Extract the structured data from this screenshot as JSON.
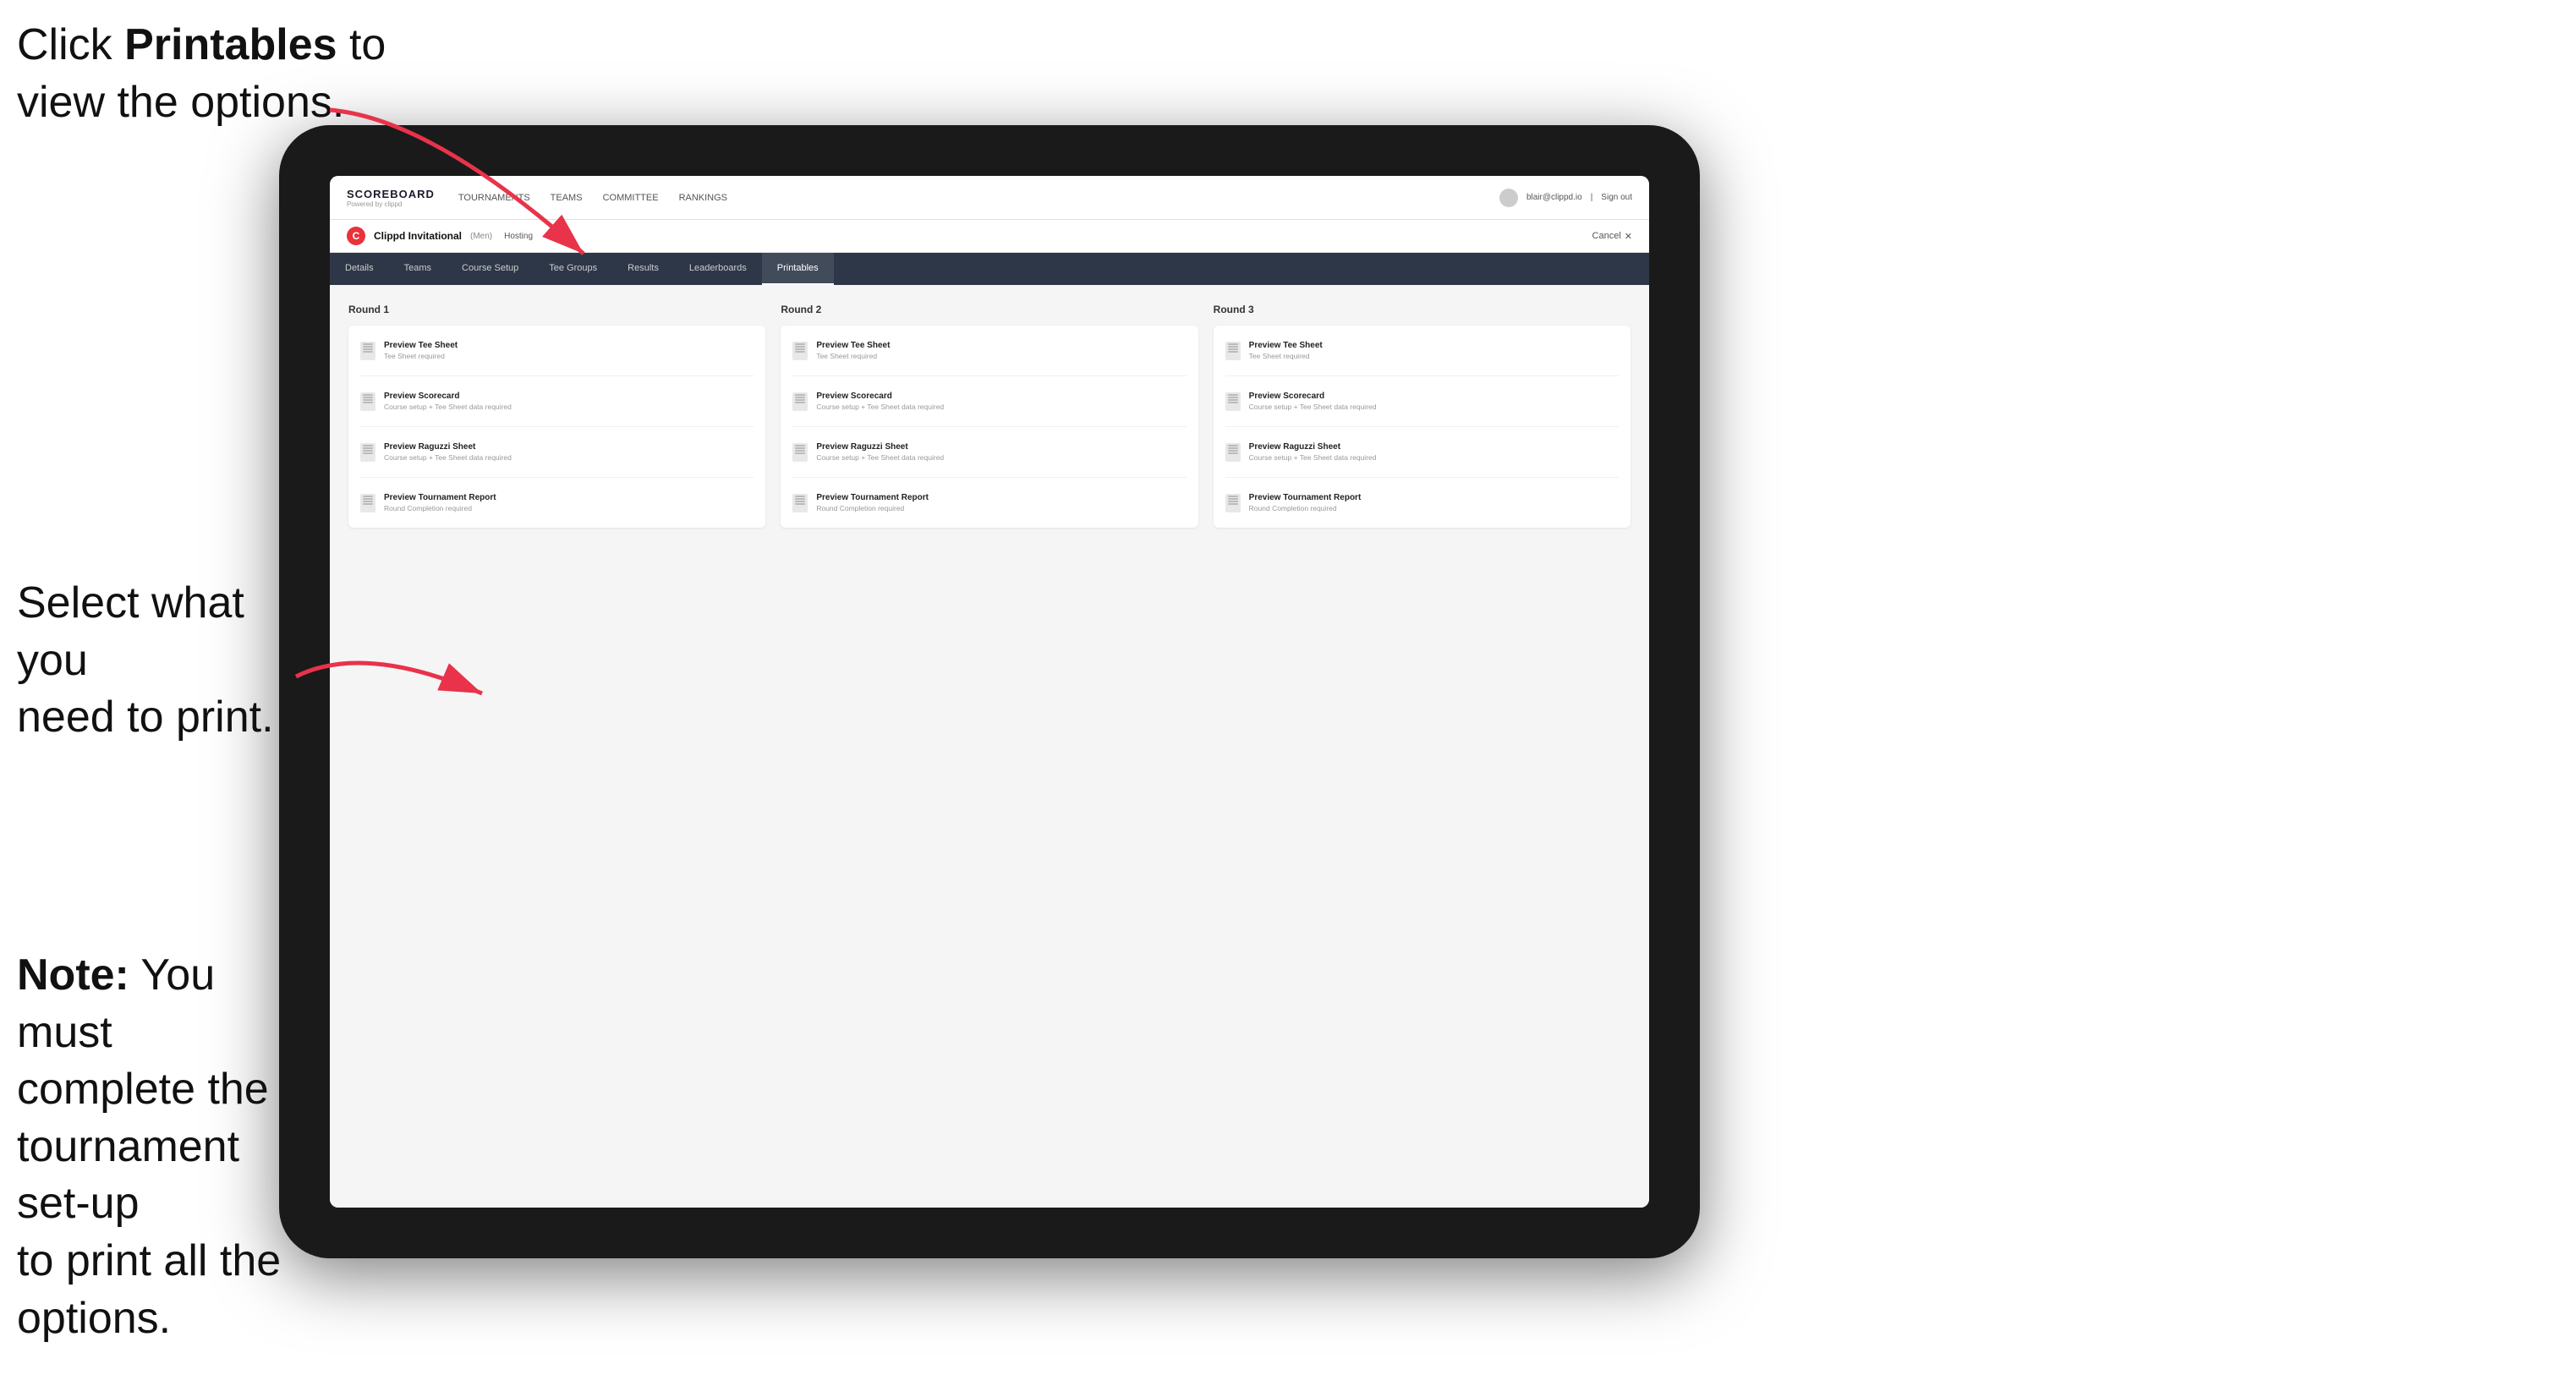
{
  "annotation": {
    "top_line1": "Click ",
    "top_bold": "Printables",
    "top_line2": " to",
    "top_line3": "view the options.",
    "middle_line1": "Select what you",
    "middle_line2": "need to print.",
    "bottom_bold": "Note:",
    "bottom_line1": " You must",
    "bottom_line2": "complete the",
    "bottom_line3": "tournament set-up",
    "bottom_line4": "to print all the options."
  },
  "nav": {
    "logo_title": "SCOREBOARD",
    "logo_subtitle": "Powered by clippd",
    "links": [
      {
        "label": "TOURNAMENTS",
        "active": false
      },
      {
        "label": "TEAMS",
        "active": false
      },
      {
        "label": "COMMITTEE",
        "active": false
      },
      {
        "label": "RANKINGS",
        "active": false
      }
    ],
    "user": "blair@clippd.io",
    "sign_out": "Sign out"
  },
  "tournament": {
    "logo_letter": "C",
    "name": "Clippd Invitational",
    "tag": "(Men)",
    "hosting": "Hosting",
    "cancel": "Cancel"
  },
  "sub_tabs": [
    {
      "label": "Details",
      "active": false
    },
    {
      "label": "Teams",
      "active": false
    },
    {
      "label": "Course Setup",
      "active": false
    },
    {
      "label": "Tee Groups",
      "active": false
    },
    {
      "label": "Results",
      "active": false
    },
    {
      "label": "Leaderboards",
      "active": false
    },
    {
      "label": "Printables",
      "active": true
    }
  ],
  "rounds": [
    {
      "title": "Round 1",
      "items": [
        {
          "title": "Preview Tee Sheet",
          "subtitle": "Tee Sheet required"
        },
        {
          "title": "Preview Scorecard",
          "subtitle": "Course setup + Tee Sheet data required"
        },
        {
          "title": "Preview Raguzzi Sheet",
          "subtitle": "Course setup + Tee Sheet data required"
        },
        {
          "title": "Preview Tournament Report",
          "subtitle": "Round Completion required"
        }
      ]
    },
    {
      "title": "Round 2",
      "items": [
        {
          "title": "Preview Tee Sheet",
          "subtitle": "Tee Sheet required"
        },
        {
          "title": "Preview Scorecard",
          "subtitle": "Course setup + Tee Sheet data required"
        },
        {
          "title": "Preview Raguzzi Sheet",
          "subtitle": "Course setup + Tee Sheet data required"
        },
        {
          "title": "Preview Tournament Report",
          "subtitle": "Round Completion required"
        }
      ]
    },
    {
      "title": "Round 3",
      "items": [
        {
          "title": "Preview Tee Sheet",
          "subtitle": "Tee Sheet required"
        },
        {
          "title": "Preview Scorecard",
          "subtitle": "Course setup + Tee Sheet data required"
        },
        {
          "title": "Preview Raguzzi Sheet",
          "subtitle": "Course setup + Tee Sheet data required"
        },
        {
          "title": "Preview Tournament Report",
          "subtitle": "Round Completion required"
        }
      ]
    }
  ]
}
